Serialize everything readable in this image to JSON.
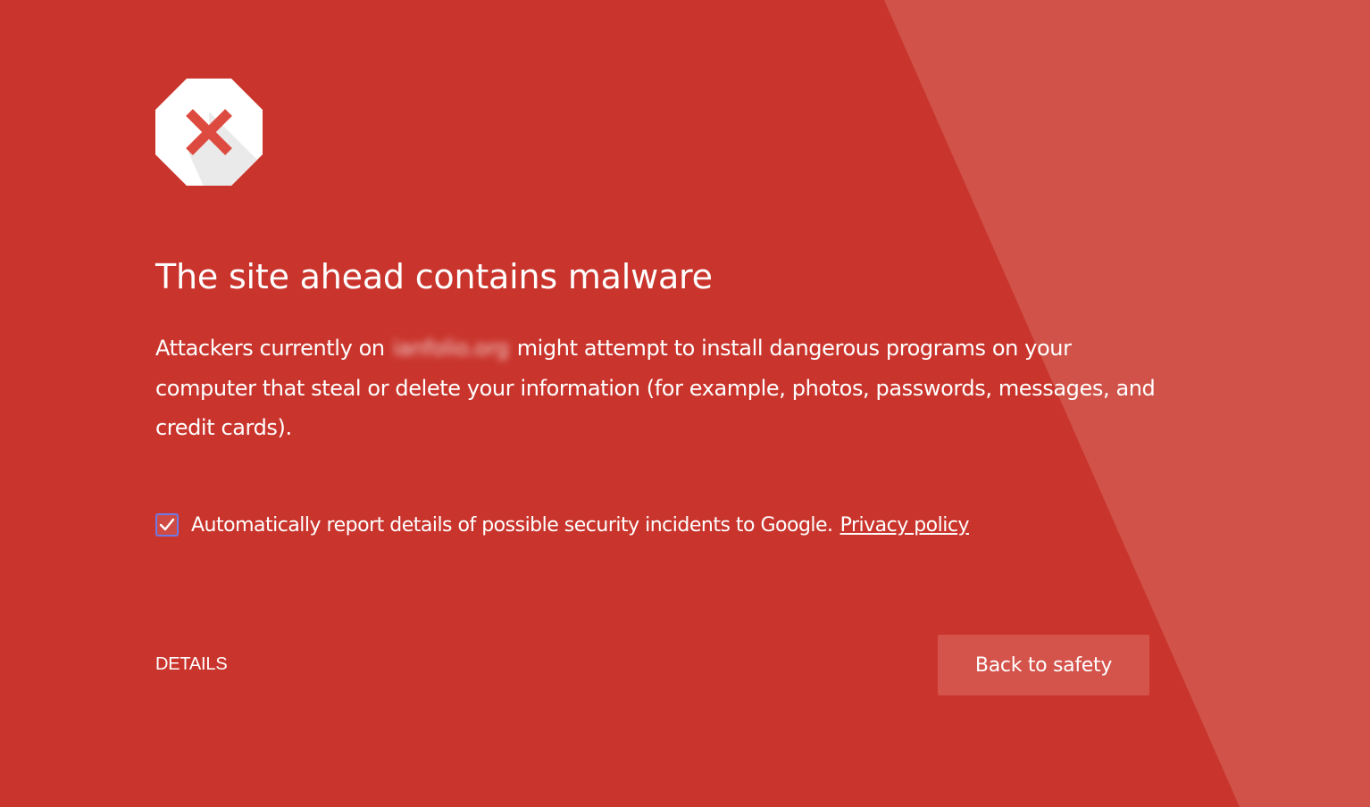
{
  "page": {
    "title": "The site ahead contains malware",
    "body_prefix": "Attackers currently on",
    "blurred_host": "ianfolio.org",
    "body_suffix": "might attempt to install dangerous programs on your computer that steal or delete your information (for example, photos, passwords, messages, and credit cards)."
  },
  "report": {
    "checked": true,
    "label": "Automatically report details of possible security incidents to Google.",
    "privacy_link": "Privacy policy"
  },
  "actions": {
    "details_label": "DETAILS",
    "back_label": "Back to safety"
  },
  "icons": {
    "warning": "stop-x-icon",
    "checkbox": "check-icon"
  },
  "colors": {
    "background": "#c9352d",
    "stripe": "#d05249",
    "button": "#d4534b",
    "icon_x": "#dd4b40",
    "checkbox_border": "#6d79e6"
  }
}
